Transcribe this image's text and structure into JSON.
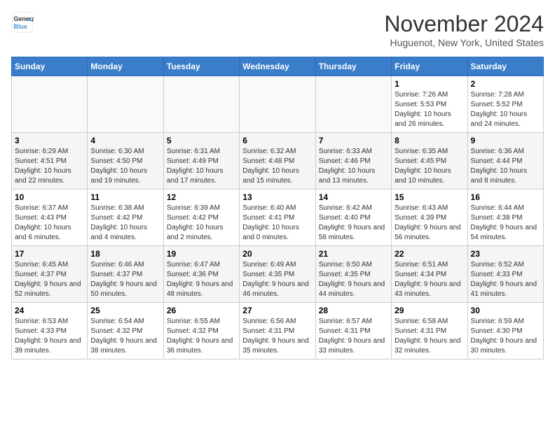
{
  "header": {
    "logo_line1": "General",
    "logo_line2": "Blue",
    "month": "November 2024",
    "location": "Huguenot, New York, United States"
  },
  "days_of_week": [
    "Sunday",
    "Monday",
    "Tuesday",
    "Wednesday",
    "Thursday",
    "Friday",
    "Saturday"
  ],
  "weeks": [
    [
      {
        "day": "",
        "empty": true
      },
      {
        "day": "",
        "empty": true
      },
      {
        "day": "",
        "empty": true
      },
      {
        "day": "",
        "empty": true
      },
      {
        "day": "",
        "empty": true
      },
      {
        "day": "1",
        "sunrise": "Sunrise: 7:26 AM",
        "sunset": "Sunset: 5:53 PM",
        "daylight": "Daylight: 10 hours and 26 minutes."
      },
      {
        "day": "2",
        "sunrise": "Sunrise: 7:28 AM",
        "sunset": "Sunset: 5:52 PM",
        "daylight": "Daylight: 10 hours and 24 minutes."
      }
    ],
    [
      {
        "day": "3",
        "sunrise": "Sunrise: 6:29 AM",
        "sunset": "Sunset: 4:51 PM",
        "daylight": "Daylight: 10 hours and 22 minutes."
      },
      {
        "day": "4",
        "sunrise": "Sunrise: 6:30 AM",
        "sunset": "Sunset: 4:50 PM",
        "daylight": "Daylight: 10 hours and 19 minutes."
      },
      {
        "day": "5",
        "sunrise": "Sunrise: 6:31 AM",
        "sunset": "Sunset: 4:49 PM",
        "daylight": "Daylight: 10 hours and 17 minutes."
      },
      {
        "day": "6",
        "sunrise": "Sunrise: 6:32 AM",
        "sunset": "Sunset: 4:48 PM",
        "daylight": "Daylight: 10 hours and 15 minutes."
      },
      {
        "day": "7",
        "sunrise": "Sunrise: 6:33 AM",
        "sunset": "Sunset: 4:46 PM",
        "daylight": "Daylight: 10 hours and 13 minutes."
      },
      {
        "day": "8",
        "sunrise": "Sunrise: 6:35 AM",
        "sunset": "Sunset: 4:45 PM",
        "daylight": "Daylight: 10 hours and 10 minutes."
      },
      {
        "day": "9",
        "sunrise": "Sunrise: 6:36 AM",
        "sunset": "Sunset: 4:44 PM",
        "daylight": "Daylight: 10 hours and 8 minutes."
      }
    ],
    [
      {
        "day": "10",
        "sunrise": "Sunrise: 6:37 AM",
        "sunset": "Sunset: 4:43 PM",
        "daylight": "Daylight: 10 hours and 6 minutes."
      },
      {
        "day": "11",
        "sunrise": "Sunrise: 6:38 AM",
        "sunset": "Sunset: 4:42 PM",
        "daylight": "Daylight: 10 hours and 4 minutes."
      },
      {
        "day": "12",
        "sunrise": "Sunrise: 6:39 AM",
        "sunset": "Sunset: 4:42 PM",
        "daylight": "Daylight: 10 hours and 2 minutes."
      },
      {
        "day": "13",
        "sunrise": "Sunrise: 6:40 AM",
        "sunset": "Sunset: 4:41 PM",
        "daylight": "Daylight: 10 hours and 0 minutes."
      },
      {
        "day": "14",
        "sunrise": "Sunrise: 6:42 AM",
        "sunset": "Sunset: 4:40 PM",
        "daylight": "Daylight: 9 hours and 58 minutes."
      },
      {
        "day": "15",
        "sunrise": "Sunrise: 6:43 AM",
        "sunset": "Sunset: 4:39 PM",
        "daylight": "Daylight: 9 hours and 56 minutes."
      },
      {
        "day": "16",
        "sunrise": "Sunrise: 6:44 AM",
        "sunset": "Sunset: 4:38 PM",
        "daylight": "Daylight: 9 hours and 54 minutes."
      }
    ],
    [
      {
        "day": "17",
        "sunrise": "Sunrise: 6:45 AM",
        "sunset": "Sunset: 4:37 PM",
        "daylight": "Daylight: 9 hours and 52 minutes."
      },
      {
        "day": "18",
        "sunrise": "Sunrise: 6:46 AM",
        "sunset": "Sunset: 4:37 PM",
        "daylight": "Daylight: 9 hours and 50 minutes."
      },
      {
        "day": "19",
        "sunrise": "Sunrise: 6:47 AM",
        "sunset": "Sunset: 4:36 PM",
        "daylight": "Daylight: 9 hours and 48 minutes."
      },
      {
        "day": "20",
        "sunrise": "Sunrise: 6:49 AM",
        "sunset": "Sunset: 4:35 PM",
        "daylight": "Daylight: 9 hours and 46 minutes."
      },
      {
        "day": "21",
        "sunrise": "Sunrise: 6:50 AM",
        "sunset": "Sunset: 4:35 PM",
        "daylight": "Daylight: 9 hours and 44 minutes."
      },
      {
        "day": "22",
        "sunrise": "Sunrise: 6:51 AM",
        "sunset": "Sunset: 4:34 PM",
        "daylight": "Daylight: 9 hours and 43 minutes."
      },
      {
        "day": "23",
        "sunrise": "Sunrise: 6:52 AM",
        "sunset": "Sunset: 4:33 PM",
        "daylight": "Daylight: 9 hours and 41 minutes."
      }
    ],
    [
      {
        "day": "24",
        "sunrise": "Sunrise: 6:53 AM",
        "sunset": "Sunset: 4:33 PM",
        "daylight": "Daylight: 9 hours and 39 minutes."
      },
      {
        "day": "25",
        "sunrise": "Sunrise: 6:54 AM",
        "sunset": "Sunset: 4:32 PM",
        "daylight": "Daylight: 9 hours and 38 minutes."
      },
      {
        "day": "26",
        "sunrise": "Sunrise: 6:55 AM",
        "sunset": "Sunset: 4:32 PM",
        "daylight": "Daylight: 9 hours and 36 minutes."
      },
      {
        "day": "27",
        "sunrise": "Sunrise: 6:56 AM",
        "sunset": "Sunset: 4:31 PM",
        "daylight": "Daylight: 9 hours and 35 minutes."
      },
      {
        "day": "28",
        "sunrise": "Sunrise: 6:57 AM",
        "sunset": "Sunset: 4:31 PM",
        "daylight": "Daylight: 9 hours and 33 minutes."
      },
      {
        "day": "29",
        "sunrise": "Sunrise: 6:58 AM",
        "sunset": "Sunset: 4:31 PM",
        "daylight": "Daylight: 9 hours and 32 minutes."
      },
      {
        "day": "30",
        "sunrise": "Sunrise: 6:59 AM",
        "sunset": "Sunset: 4:30 PM",
        "daylight": "Daylight: 9 hours and 30 minutes."
      }
    ]
  ]
}
